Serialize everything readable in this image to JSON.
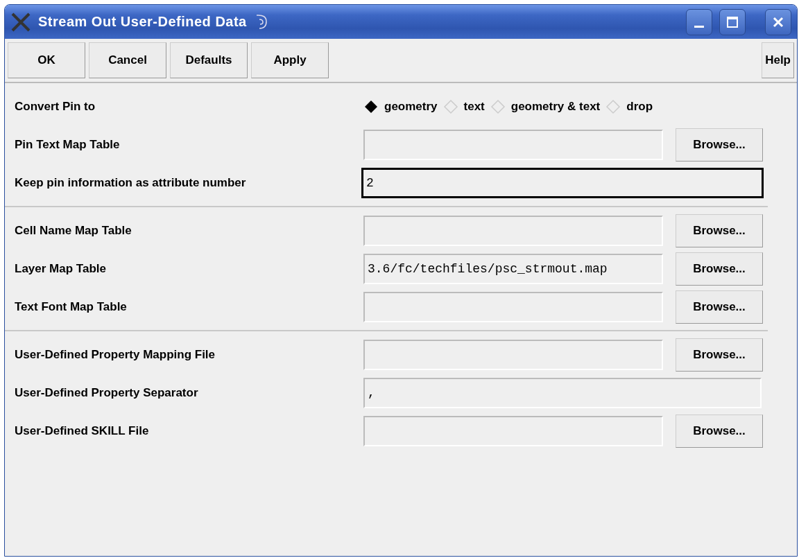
{
  "window": {
    "title": "Stream Out User-Defined Data"
  },
  "toolbar": {
    "buttons": [
      "OK",
      "Cancel",
      "Defaults",
      "Apply"
    ],
    "help": "Help"
  },
  "sections": [
    {
      "rows": [
        {
          "kind": "radio",
          "label": "Convert Pin to",
          "options": [
            {
              "label": "geometry",
              "selected": true
            },
            {
              "label": "text",
              "selected": false
            },
            {
              "label": "geometry & text",
              "selected": false
            },
            {
              "label": "drop",
              "selected": false
            }
          ]
        },
        {
          "kind": "file",
          "label": "Pin Text Map Table",
          "browse": "Browse...",
          "focused": false
        },
        {
          "kind": "text",
          "label": "Keep pin information as attribute number",
          "value": "2",
          "focused": true
        }
      ]
    },
    {
      "rows": [
        {
          "kind": "file",
          "label": "Cell Name Map Table",
          "browse": "Browse...",
          "focused": false
        },
        {
          "kind": "file",
          "label": "Layer Map Table",
          "value": "3.6/fc/techfiles/psc_strmout.map",
          "browse": "Browse...",
          "focused": false
        },
        {
          "kind": "file",
          "label": "Text Font Map Table",
          "browse": "Browse...",
          "focused": false
        }
      ]
    },
    {
      "rows": [
        {
          "kind": "file",
          "label": "User-Defined Property Mapping File",
          "browse": "Browse...",
          "focused": false
        },
        {
          "kind": "text",
          "label": "User-Defined Property Separator",
          "value": ",",
          "focused": false
        },
        {
          "kind": "file",
          "label": "User-Defined SKILL File",
          "browse": "Browse...",
          "focused": false
        }
      ]
    }
  ]
}
